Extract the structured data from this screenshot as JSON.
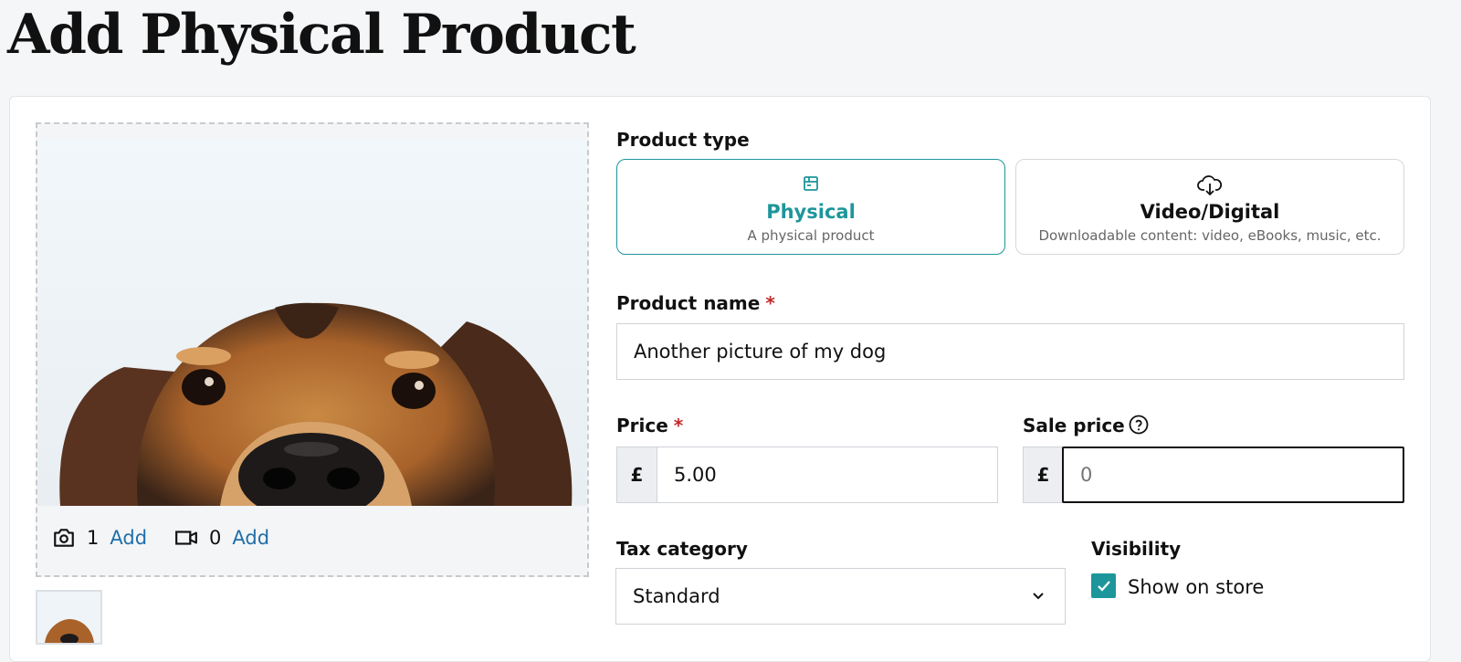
{
  "page": {
    "title": "Add Physical Product"
  },
  "media": {
    "photo_count": "1",
    "photo_add_label": "Add",
    "video_count": "0",
    "video_add_label": "Add",
    "photo_icon": "camera-icon",
    "video_icon": "video-camera-icon"
  },
  "product_type": {
    "label": "Product type",
    "options": [
      {
        "title": "Physical",
        "subtitle": "A physical product",
        "icon": "box-icon",
        "selected": true
      },
      {
        "title": "Video/Digital",
        "subtitle": "Downloadable content: video, eBooks, music, etc.",
        "icon": "cloud-download-icon",
        "selected": false
      }
    ]
  },
  "product_name": {
    "label": "Product name",
    "required_mark": "*",
    "value": "Another picture of my dog"
  },
  "price": {
    "label": "Price",
    "required_mark": "*",
    "currency": "£",
    "value": "5.00"
  },
  "sale_price": {
    "label": "Sale price",
    "currency": "£",
    "value": "",
    "placeholder": "0",
    "help_icon": "help-circle-icon"
  },
  "tax_category": {
    "label": "Tax category",
    "selected": "Standard"
  },
  "visibility": {
    "label": "Visibility",
    "checkbox_label": "Show on store",
    "checked": true
  },
  "colors": {
    "accent": "#1d969b",
    "link": "#1f6fa8",
    "required": "#c62828"
  }
}
